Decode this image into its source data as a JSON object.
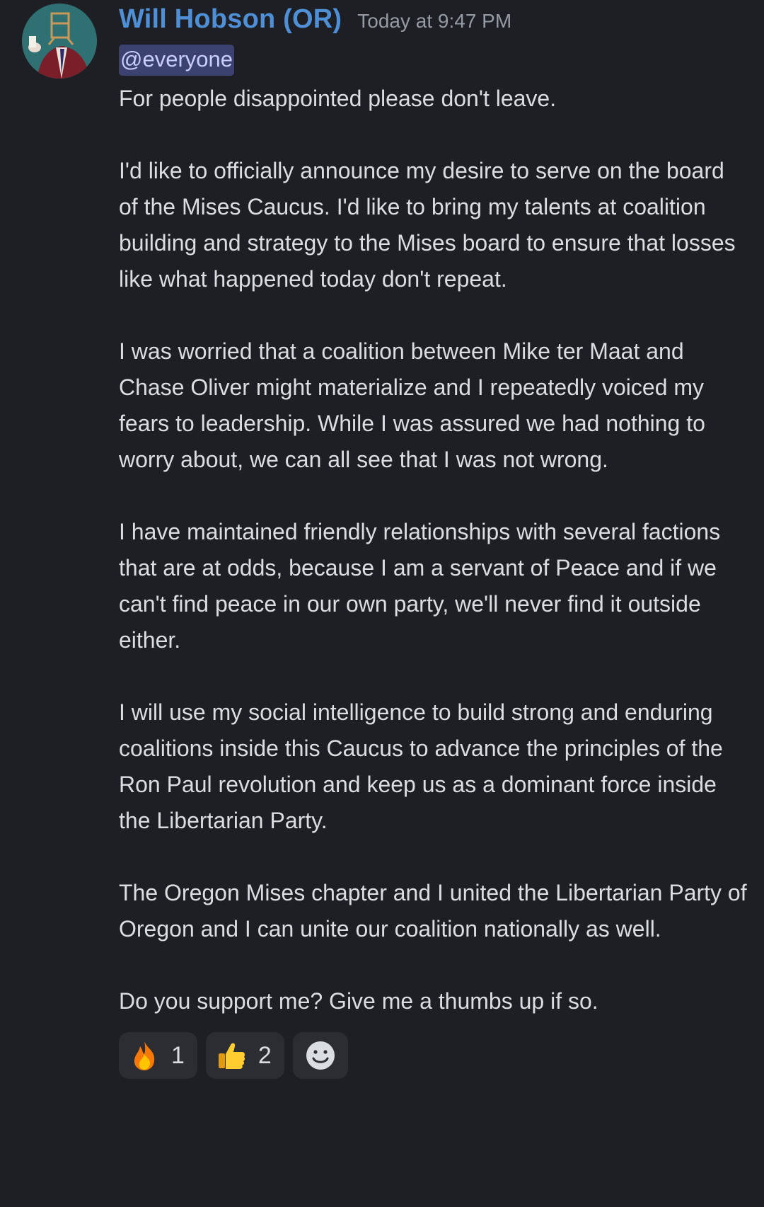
{
  "message": {
    "author": "Will Hobson (OR)",
    "timestamp": "Today at 9:47 PM",
    "mention": "@everyone",
    "paragraphs": [
      "For people disappointed please don't leave.",
      "I'd like to officially announce my desire to serve on the board of the Mises Caucus. I'd like to bring my talents at coalition building and strategy to the Mises board to ensure that losses like what happened today don't repeat.",
      "I was worried that a coalition between Mike ter Maat and Chase Oliver might materialize and I repeatedly voiced my fears to leadership. While I was assured we had nothing to worry about, we can all see that I was not wrong.",
      "I have maintained friendly relationships with several factions that are at odds, because I am a servant of Peace and if we can't find peace in our own party, we'll never find it outside either.",
      "I will use my social intelligence to build strong and enduring coalitions inside this Caucus to advance the principles of the Ron Paul revolution and keep us as a dominant force inside the Libertarian Party.",
      "The Oregon Mises chapter and I united the Libertarian Party of Oregon and I can unite our coalition nationally as well.",
      "Do you support me? Give me a thumbs up if so."
    ],
    "reactions": [
      {
        "emoji": "fire-emoji",
        "count": "1"
      },
      {
        "emoji": "thumbs-up-emoji",
        "count": "2"
      }
    ],
    "add_reaction_icon": "smiley-add-reaction-icon"
  },
  "colors": {
    "background": "#1e1f24",
    "username": "#4f8fd6",
    "timestamp": "#949ba4",
    "mention_bg": "#3c4270",
    "mention_text": "#c9cdfb",
    "text": "#dbdee1",
    "reaction_bg": "#2b2d33"
  }
}
